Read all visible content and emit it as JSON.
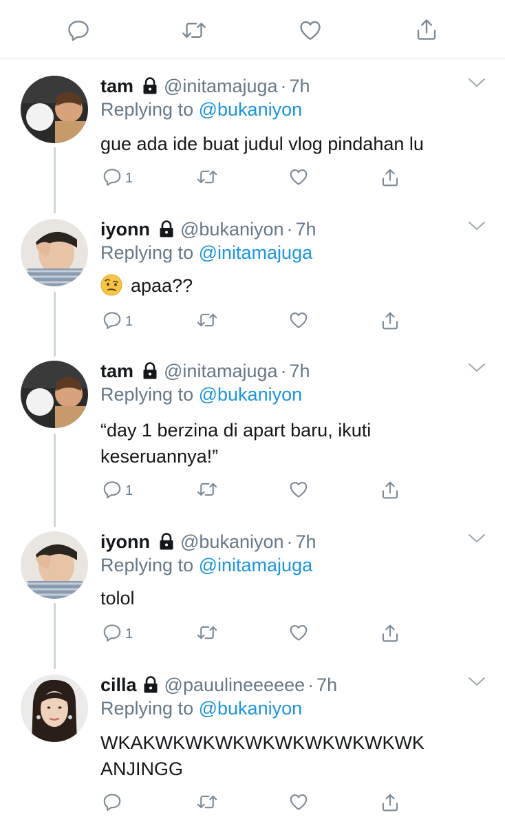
{
  "top_actions": [
    "reply-icon",
    "retweet-icon",
    "like-icon",
    "share-icon"
  ],
  "replying_prefix": "Replying to",
  "tweets": [
    {
      "name": "tam",
      "handle": "@initamajuga",
      "separator": "·",
      "time": "7h",
      "replying_to": "@bukaniyon",
      "lines": [
        "gue ada ide buat judul vlog pindahan lu"
      ],
      "reply_count": "1"
    },
    {
      "name": "iyonn",
      "handle": "@bukaniyon",
      "separator": "·",
      "time": "7h",
      "replying_to": "@initamajuga",
      "emoji": "raised-eyebrow-emoji",
      "lines": [
        "apaa??"
      ],
      "reply_count": "1"
    },
    {
      "name": "tam",
      "handle": "@initamajuga",
      "separator": "·",
      "time": "7h",
      "replying_to": "@bukaniyon",
      "lines": [
        "“day 1 berzina di apart baru, ikuti",
        "keseruannya!”"
      ],
      "reply_count": "1"
    },
    {
      "name": "iyonn",
      "handle": "@bukaniyon",
      "separator": "·",
      "time": "7h",
      "replying_to": "@initamajuga",
      "lines": [
        "tolol"
      ],
      "reply_count": "1"
    },
    {
      "name": "cilla",
      "handle": "@pauulineeeeee",
      "separator": "·",
      "time": "7h",
      "replying_to": "@bukaniyon",
      "lines": [
        "WKAKWKWKWKWKWKWKWKWKWK",
        "ANJINGG"
      ],
      "reply_count": ""
    }
  ],
  "colors": {
    "text": "#14171a",
    "secondary": "#657786",
    "link": "#1b95e0",
    "icon": "#7d8a96",
    "divider": "#e1e8ed",
    "thread_line": "#ccd6dd"
  }
}
